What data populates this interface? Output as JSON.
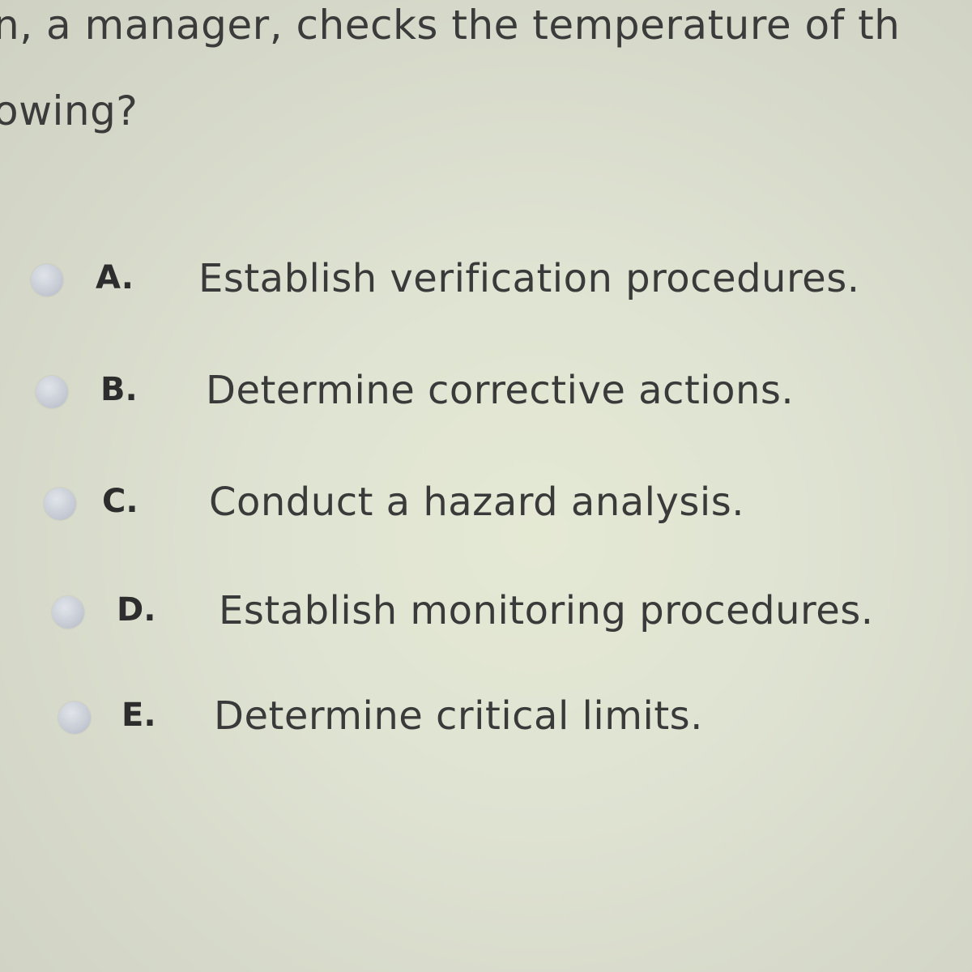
{
  "question": {
    "line1": "n, a manager, checks the temperature of th",
    "line2": "owing?"
  },
  "options": [
    {
      "letter": "A.",
      "text": "Establish verification procedures."
    },
    {
      "letter": "B.",
      "text": "Determine corrective actions."
    },
    {
      "letter": "C.",
      "text": "Conduct a hazard analysis."
    },
    {
      "letter": "D.",
      "text": "Establish monitoring procedures."
    },
    {
      "letter": "E.",
      "text": "Determine critical limits."
    }
  ]
}
